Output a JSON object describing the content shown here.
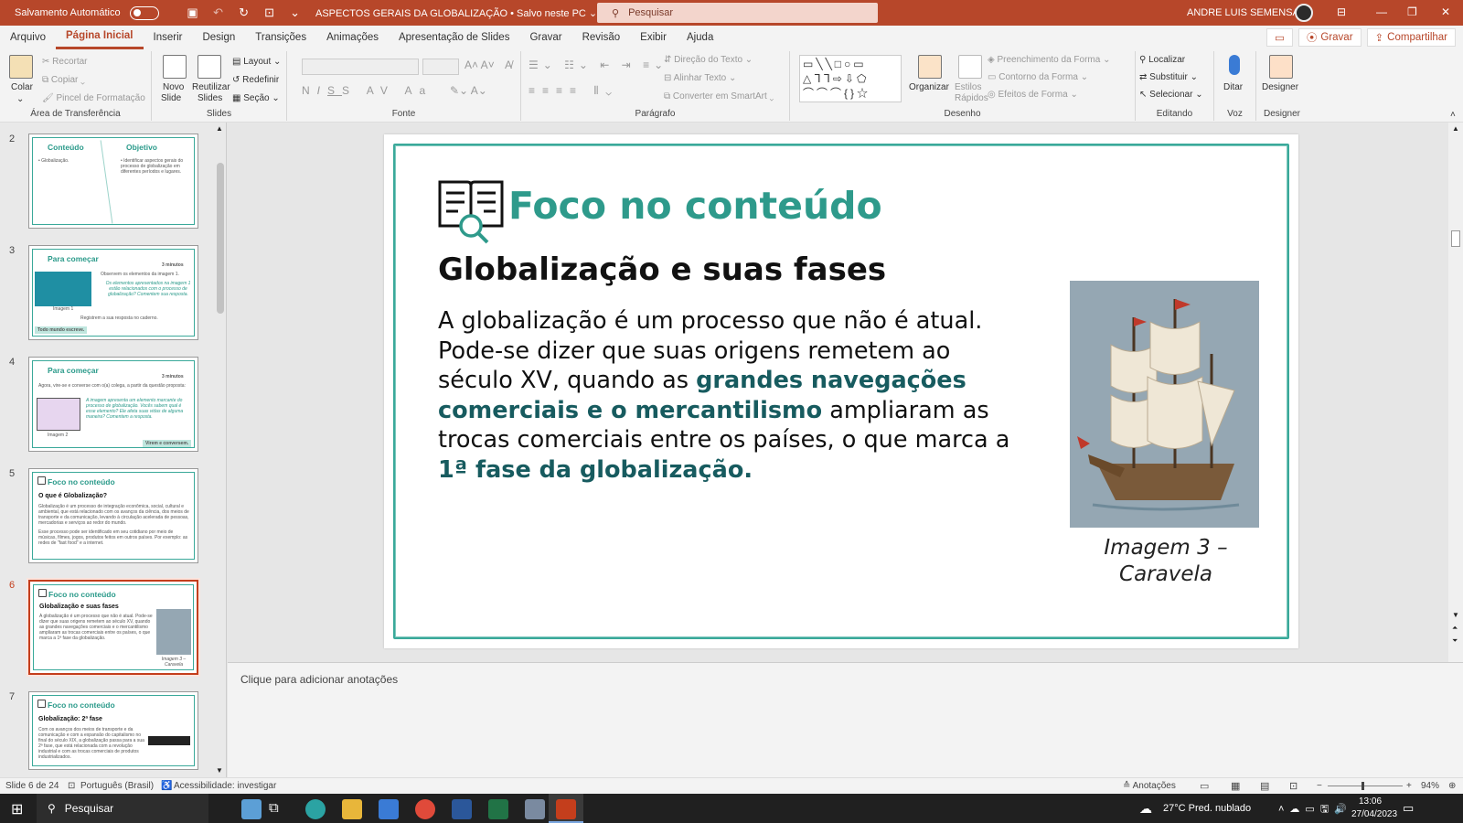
{
  "titlebar": {
    "autosave_label": "Salvamento Automático",
    "doc_title": "ASPECTOS GERAIS DA GLOBALIZAÇÃO • Salvo neste PC ⌄",
    "search_placeholder": "Pesquisar",
    "user": "ANDRE LUIS SEMENSATO"
  },
  "menu": {
    "items": [
      "Arquivo",
      "Página Inicial",
      "Inserir",
      "Design",
      "Transições",
      "Animações",
      "Apresentação de Slides",
      "Gravar",
      "Revisão",
      "Exibir",
      "Ajuda"
    ],
    "record": "Gravar",
    "share": "Compartilhar"
  },
  "ribbon": {
    "clipboard": {
      "paste": "Colar",
      "cut": "Recortar",
      "copy": "Copiar",
      "painter": "Pincel de Formatação",
      "label": "Área de Transferência"
    },
    "slides": {
      "new": "Novo",
      "new2": "Slide",
      "reuse": "Reutilizar",
      "reuse2": "Slides",
      "layout": "Layout",
      "reset": "Redefinir",
      "section": "Seção",
      "label": "Slides"
    },
    "font": {
      "label": "Fonte"
    },
    "paragraph": {
      "direction": "Direção do Texto",
      "align": "Alinhar Texto",
      "smartart": "Converter em SmartArt",
      "label": "Parágrafo"
    },
    "drawing": {
      "arrange": "Organizar",
      "styles": "Estilos",
      "styles2": "Rápidos",
      "fill": "Preenchimento da Forma",
      "outline": "Contorno da Forma",
      "effects": "Efeitos de Forma",
      "label": "Desenho"
    },
    "editing": {
      "find": "Localizar",
      "replace": "Substituir",
      "select": "Selecionar",
      "label": "Editando"
    },
    "voice": {
      "dictate": "Ditar",
      "label": "Voz"
    },
    "designer": {
      "designer": "Designer",
      "label": "Designer"
    }
  },
  "thumbnails": [
    {
      "num": "2",
      "title": "Conteúdo",
      "title2": "Objetivo",
      "body": "• Globalização.",
      "body2": "• Identificar aspectos gerais do processo de globalização em diferentes períodos e lugares."
    },
    {
      "num": "3",
      "title": "Para começar",
      "time": "3 minutos",
      "body": "Observem os elementos da imagem 1.",
      "body2": "Os elementos apresentados na imagem 1 estão relacionados com o processo de globalização? Comentem sua resposta.",
      "caption": "Imagem 1",
      "note": "Registrem a sua resposta no caderno.",
      "tag": "Todo mundo escreve."
    },
    {
      "num": "4",
      "title": "Para começar",
      "time": "3 minutos",
      "body": "Agora, vire-se e converse com o(a) colega, a partir da questão proposta:",
      "body2": "A imagem apresenta um elemento marcante do processo de globalização. Vocês sabem qual é esse elemento? Ele afeta suas vidas de alguma maneira? Comentem a resposta.",
      "caption": "Imagem 2",
      "tag": "Virem e conversem."
    },
    {
      "num": "5",
      "title": "Foco no conteúdo",
      "sub": "O que é Globalização?",
      "body": "Globalização é um processo de integração econômica, social, cultural e ambiental, que está relacionado com os avanços da ciência, dos meios de transporte e da comunicação, levando à circulação acelerada de pessoas, mercadorias e serviços ao redor do mundo.",
      "body2": "Esse processo pode ser identificado em seu cotidiano por meio de músicas, filmes, jogos, produtos feitos em outros países. Por exemplo: as redes de \"fast food\" e a internet."
    },
    {
      "num": "6",
      "title": "Foco no conteúdo",
      "sub": "Globalização e suas fases",
      "body": "A globalização é um processo que não é atual. Pode-se dizer que suas origens remetem ao século XV, quando as grandes navegações comerciais e o mercantilismo ampliaram as trocas comerciais entre os países, o que marca a 1ª fase da globalização.",
      "caption": "Imagem 3 – Caravela"
    },
    {
      "num": "7",
      "title": "Foco no conteúdo",
      "sub": "Globalização: 2ª fase",
      "body": "Com os avanços dos meios de transporte e da comunicação e com a expansão do capitalismo no final do século XIX, a globalização passa para a sua 2ª fase, que está relacionada com a revolução industrial e com as trocas comerciais de produtos industrializados."
    }
  ],
  "slide": {
    "title": "Foco no conteúdo",
    "subtitle": "Globalização e suas fases",
    "body_1": "A globalização é um processo que não é atual. Pode-se dizer que suas origens remetem ao século XV, quando as ",
    "body_bold_1": "grandes navegações comerciais e o mercantilismo",
    "body_2": " ampliaram as trocas comerciais entre os países, o que marca a ",
    "body_bold_2": "1ª fase da globalização.",
    "caption": "Imagem 3 – Caravela"
  },
  "notes_placeholder": "Clique para adicionar anotações",
  "status": {
    "slide": "Slide 6 de 24",
    "lang": "Português (Brasil)",
    "access": "Acessibilidade: investigar",
    "notes": "Anotações",
    "zoom": "94%"
  },
  "taskbar": {
    "search": "Pesquisar",
    "weather": "27°C  Pred. nublado",
    "time": "13:06",
    "date": "27/04/2023"
  },
  "colors": {
    "accent": "#b7472a",
    "teal": "#2e9a8b",
    "dark_teal": "#175b5f"
  }
}
